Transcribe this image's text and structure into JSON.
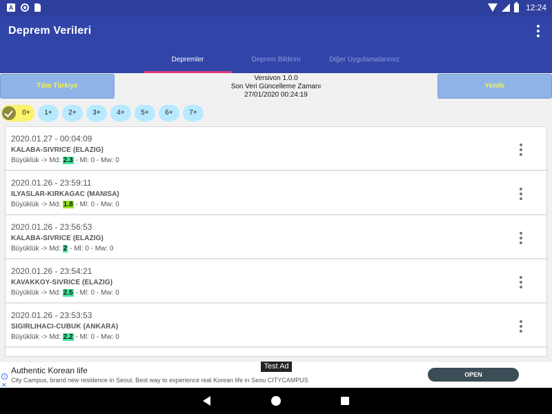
{
  "statusbar": {
    "time": "12:24",
    "left_icons": [
      "a-notification-icon",
      "circle-notification-icon",
      "sd-card-icon"
    ],
    "right_icons": [
      "wifi-icon",
      "signal-icon",
      "battery-icon"
    ]
  },
  "appbar": {
    "title": "Deprem Verileri",
    "menu_icon": "more-vert-icon"
  },
  "tabs": [
    {
      "label": "Depremler",
      "active": true
    },
    {
      "label": "Deprem Bildirim",
      "active": false
    },
    {
      "label": "Diğer Uygulamalarımız",
      "active": false
    }
  ],
  "header": {
    "all_button": "Tüm Türkiye",
    "refresh_button": "Yenile",
    "version": "Versivon 1.0.0",
    "update_label": "Son Veri Güncelleme Zamanı",
    "update_time": "27/01/2020 00:24:19"
  },
  "filters": [
    {
      "label": "0+",
      "selected": true
    },
    {
      "label": "1+",
      "selected": false
    },
    {
      "label": "2+",
      "selected": false
    },
    {
      "label": "3+",
      "selected": false
    },
    {
      "label": "4+",
      "selected": false
    },
    {
      "label": "5+",
      "selected": false
    },
    {
      "label": "6+",
      "selected": false
    },
    {
      "label": "7+",
      "selected": false
    }
  ],
  "quakes": [
    {
      "date": "2020.01.27 - 00:04:09",
      "place": "KALABA-SIVRICE (ELAZIG)",
      "prefix": "Büyüklük -> Md: ",
      "md": "2.3",
      "suffix": " - Ml: 0 - Mw: 0",
      "md_color": "#3fe79a"
    },
    {
      "date": "2020.01.26 - 23:59:11",
      "place": "ILYASLAR-KIRKAGAC (MANISA)",
      "prefix": "Büyüklük -> Md: ",
      "md": "1.8",
      "suffix": " - Ml: 0 - Mw: 0",
      "md_color": "#90e51c"
    },
    {
      "date": "2020.01.26 - 23:56:53",
      "place": "KALABA-SIVRICE (ELAZIG)",
      "prefix": "Büyüklük -> Md: ",
      "md": "2",
      "suffix": " - Ml: 0 - Mw: 0",
      "md_color": "#3fe79a"
    },
    {
      "date": "2020.01.26 - 23:54:21",
      "place": "KAVAKKOY-SIVRICE (ELAZIG)",
      "prefix": "Büyüklük -> Md: ",
      "md": "2.5",
      "suffix": " - Ml: 0 - Mw: 0",
      "md_color": "#3fe79a"
    },
    {
      "date": "2020.01.26 - 23:53:53",
      "place": "SIGIRLIHACI-CUBUK (ANKARA)",
      "prefix": "Büyüklük -> Md: ",
      "md": "2.2",
      "suffix": " - Ml: 0 - Mw: 0",
      "md_color": "#3fe79a"
    }
  ],
  "ad": {
    "badge": "Test Ad",
    "headline": "Authentic Korean life",
    "body": "City Campus, brand new residence in Seoul, Best way to experience real Korean life in Seou",
    "advertiser": "CITYCAMPUS",
    "cta": "OPEN",
    "info_glyph": "i",
    "close_glyph": "✕"
  },
  "navbar": {
    "icons": [
      "back-icon",
      "home-icon",
      "recents-icon"
    ]
  },
  "colors": {
    "primary": "#3144a8",
    "status": "#2f3f9e",
    "tab_indicator": "#e23b7e",
    "chip": "#b7e9ff",
    "chip_selected": "#fbf36b",
    "button": "#8fb4e8"
  }
}
